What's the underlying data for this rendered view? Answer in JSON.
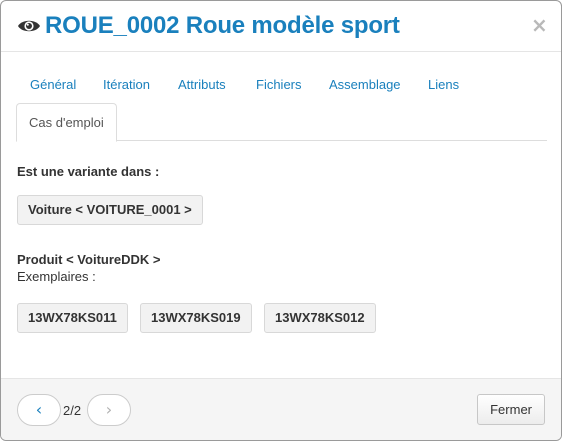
{
  "header": {
    "title": "ROUE_0002 Roue modèle sport",
    "close_symbol": "×",
    "icons": {
      "view": "eye-icon",
      "close": "close-icon"
    }
  },
  "tabs": [
    {
      "label": "Général",
      "active": false
    },
    {
      "label": "Itération",
      "active": false
    },
    {
      "label": "Attributs",
      "active": false
    },
    {
      "label": "Fichiers",
      "active": false
    },
    {
      "label": "Assemblage",
      "active": false
    },
    {
      "label": "Liens",
      "active": false
    },
    {
      "label": "Cas d'emploi",
      "active": true
    }
  ],
  "usage": {
    "variant_heading": "Est une variante dans :",
    "variant_items": [
      "Voiture < VOITURE_0001 >"
    ],
    "product_heading": "Produit < VoitureDDK >",
    "instances_label": "Exemplaires :",
    "instances": [
      "13WX78KS011",
      "13WX78KS019",
      "13WX78KS012"
    ]
  },
  "footer": {
    "pager": {
      "prev_symbol": "‹",
      "next_symbol": "›",
      "count": "2/2"
    },
    "close_label": "Fermer"
  },
  "colors": {
    "accent": "#1a80bd",
    "text": "#333333",
    "chip_bg": "#f2f2f2",
    "footer_bg": "#f5f5f5"
  }
}
